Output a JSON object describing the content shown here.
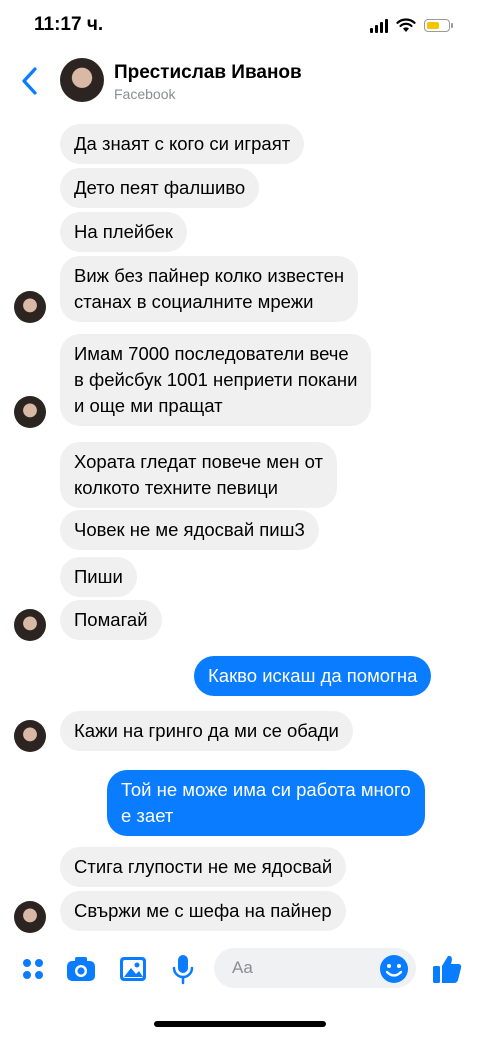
{
  "status": {
    "time": "11:17 ч.",
    "battery_level": 0.6,
    "battery_color": "#f5c400"
  },
  "header": {
    "name": "Престислав Иванов",
    "subtitle": "Facebook",
    "back_icon": "chevron-left-icon"
  },
  "messages": [
    {
      "side": "in",
      "text": "Да знаят с кого си играят"
    },
    {
      "side": "in",
      "text": "Дето пеят фалшиво"
    },
    {
      "side": "in",
      "text": "На плейбек"
    },
    {
      "side": "in",
      "text": "Виж без пайнер колко известен\nстанах в социалните мрежи"
    },
    {
      "side": "in",
      "text": "Имам 7000 последователи вече\nв фейсбук 1001 неприети покани\nи още ми пращат"
    },
    {
      "side": "in",
      "text": "Хората гледат повече мен от\nколкото техните певици"
    },
    {
      "side": "in",
      "text": "Човек не ме ядосвай пиш3"
    },
    {
      "side": "in",
      "text": "Пиши"
    },
    {
      "side": "in",
      "text": "Помагай"
    },
    {
      "side": "out",
      "text": "Какво искаш да помогна"
    },
    {
      "side": "in",
      "text": "Кажи на гринго да ми се обади"
    },
    {
      "side": "out",
      "text": "Той не може има си работа много\nе зает"
    },
    {
      "side": "in",
      "text": "Стига глупости не ме ядосвай"
    },
    {
      "side": "in",
      "text": "Свържи ме с шефа на пайнер"
    }
  ],
  "composer": {
    "placeholder": "Aa",
    "icons": [
      "menu-dots-icon",
      "camera-icon",
      "photo-icon",
      "microphone-icon",
      "emoji-icon",
      "thumbs-up-icon"
    ],
    "accent": "#0a7cff"
  },
  "colors": {
    "incoming_bubble": "#f0f0f0",
    "outgoing_bubble": "#0a7cff",
    "accent": "#0a7cff"
  }
}
